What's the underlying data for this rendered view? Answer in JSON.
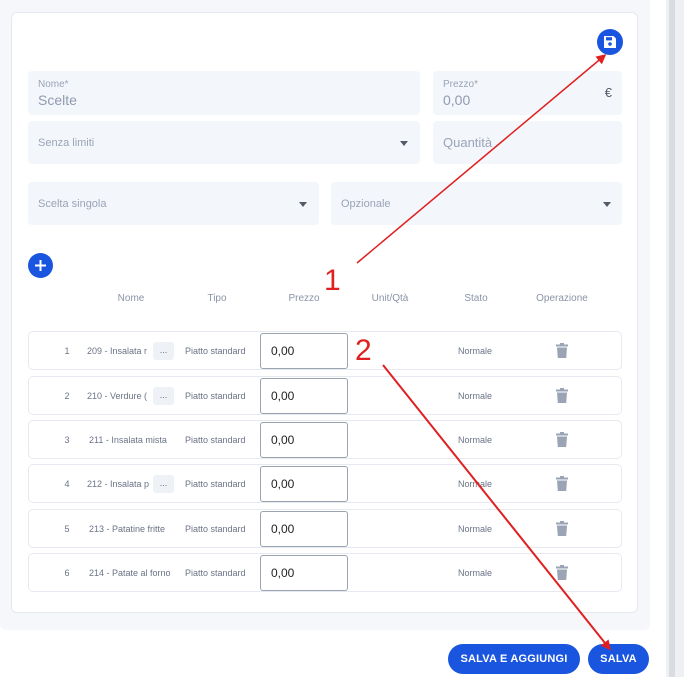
{
  "form": {
    "nome_label": "Nome*",
    "nome_value": "Scelte",
    "prezzo_label": "Prezzo*",
    "prezzo_value": "0,00",
    "prezzo_suffix": "€",
    "limiti_placeholder": "Senza limiti",
    "quantita_placeholder": "Quantità",
    "scelta_placeholder": "Scelta singola",
    "opzionale_placeholder": "Opzionale"
  },
  "table": {
    "headers": [
      "Nome",
      "Tipo",
      "Prezzo",
      "Unit/Qtà",
      "Stato",
      "Operazione"
    ],
    "rows": [
      {
        "num": "1",
        "name": "209 - Insalata r",
        "truncated": true,
        "tipo": "Piatto standard",
        "prezzo": "0,00",
        "stato": "Normale"
      },
      {
        "num": "2",
        "name": "210 - Verdure (",
        "truncated": true,
        "tipo": "Piatto standard",
        "prezzo": "0,00",
        "stato": "Normale"
      },
      {
        "num": "3",
        "name": "211 - Insalata mista",
        "truncated": false,
        "tipo": "Piatto standard",
        "prezzo": "0,00",
        "stato": "Normale"
      },
      {
        "num": "4",
        "name": "212 - Insalata p",
        "truncated": true,
        "tipo": "Piatto standard",
        "prezzo": "0,00",
        "stato": "Normale"
      },
      {
        "num": "5",
        "name": "213 - Patatine fritte",
        "truncated": false,
        "tipo": "Piatto standard",
        "prezzo": "0,00",
        "stato": "Normale"
      },
      {
        "num": "6",
        "name": "214 - Patate al forno",
        "truncated": false,
        "tipo": "Piatto standard",
        "prezzo": "0,00",
        "stato": "Normale"
      }
    ],
    "ellipsis": "..."
  },
  "footer": {
    "save_add_label": "SALVA E AGGIUNGI",
    "save_label": "SALVA"
  },
  "annotations": {
    "label_1": "1",
    "label_2": "2"
  },
  "colors": {
    "accent": "#1a55e0",
    "annotation": "#e02020"
  },
  "icons": [
    "floppy-disk-icon",
    "plus-icon",
    "chevron-down-icon",
    "trash-icon"
  ]
}
